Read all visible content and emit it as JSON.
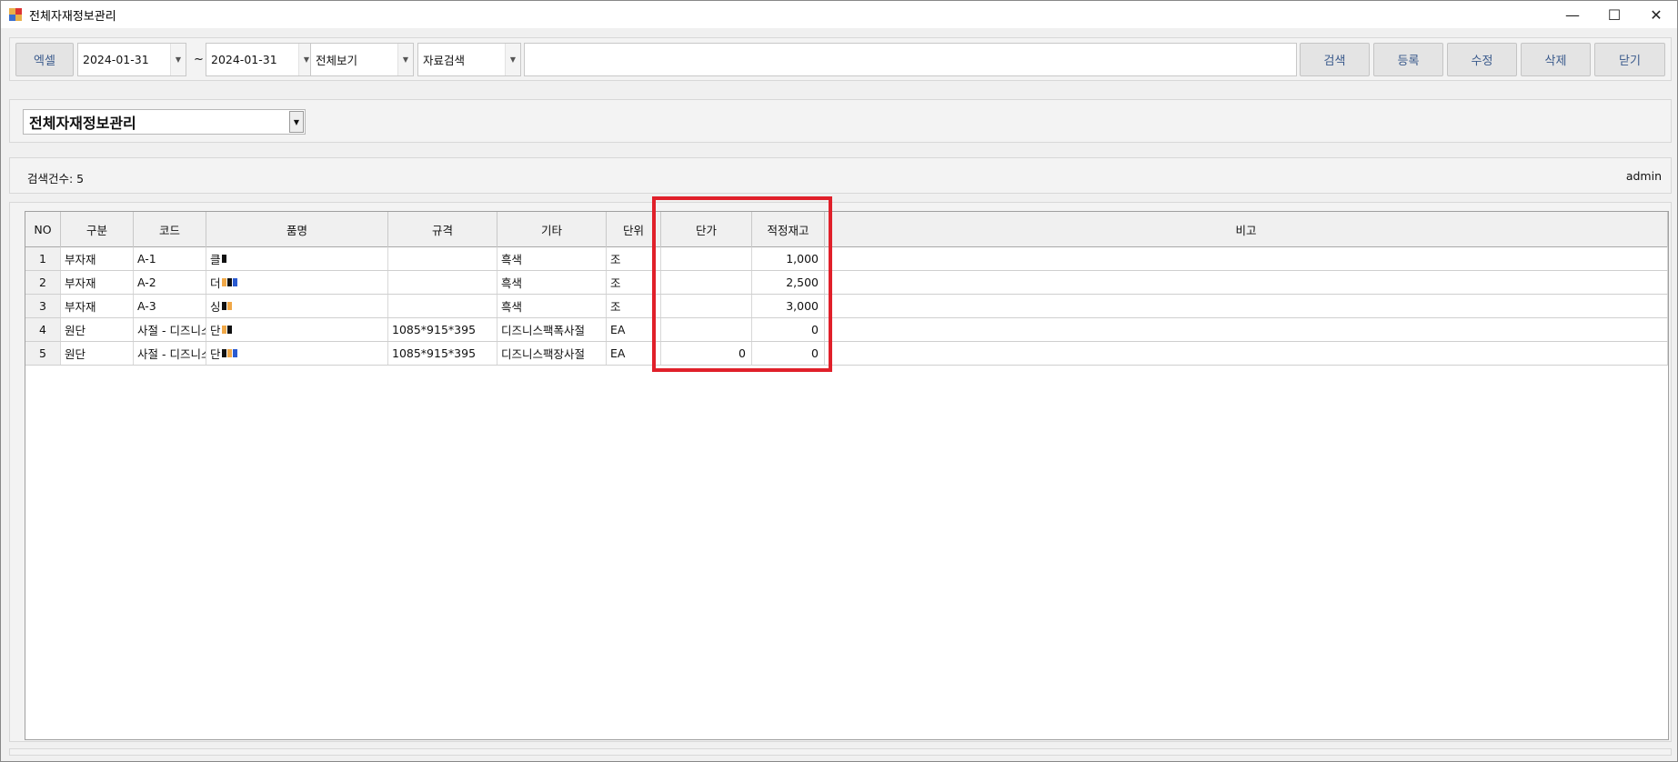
{
  "window": {
    "title": "전체자재정보관리",
    "min": "—",
    "max": "☐",
    "close": "✕"
  },
  "toolbar": {
    "excel": "엑셀",
    "date_from": "2024-01-31",
    "tilde": "~",
    "date_to": "2024-01-31",
    "view_filter": "전체보기",
    "search_field": "자료검색",
    "search_value": "",
    "search": "검색",
    "register": "등록",
    "edit": "수정",
    "delete": "삭제",
    "close": "닫기"
  },
  "form_select": "전체자재정보관리",
  "status": {
    "count_label": "검색건수: 5",
    "user": "admin"
  },
  "table": {
    "headers": [
      "NO",
      "구분",
      "코드",
      "품명",
      "규격",
      "기타",
      "단위",
      "단가",
      "적정재고",
      "비고"
    ],
    "rows": [
      {
        "no": "1",
        "type": "부자재",
        "code": "A-1",
        "name": "클",
        "spec": "",
        "etc": "흑색",
        "unit": "조",
        "price": "",
        "stock": "1,000",
        "note": ""
      },
      {
        "no": "2",
        "type": "부자재",
        "code": "A-2",
        "name": "더",
        "spec": "",
        "etc": "흑색",
        "unit": "조",
        "price": "",
        "stock": "2,500",
        "note": ""
      },
      {
        "no": "3",
        "type": "부자재",
        "code": "A-3",
        "name": "싱",
        "spec": "",
        "etc": "흑색",
        "unit": "조",
        "price": "",
        "stock": "3,000",
        "note": ""
      },
      {
        "no": "4",
        "type": "원단",
        "code": "사절 - 디즈니스",
        "name": "단",
        "spec": "1085*915*395",
        "etc": "디즈니스팩폭사절",
        "unit": "EA",
        "price": "",
        "stock": "0",
        "note": ""
      },
      {
        "no": "5",
        "type": "원단",
        "code": "사절 - 디즈니스",
        "name": "단",
        "spec": "1085*915*395",
        "etc": "디즈니스팩장사절",
        "unit": "EA",
        "price": "0",
        "stock": "0",
        "note": ""
      }
    ]
  },
  "colors": {
    "highlight": "#e0202a",
    "button_text": "#3a5a8c"
  }
}
